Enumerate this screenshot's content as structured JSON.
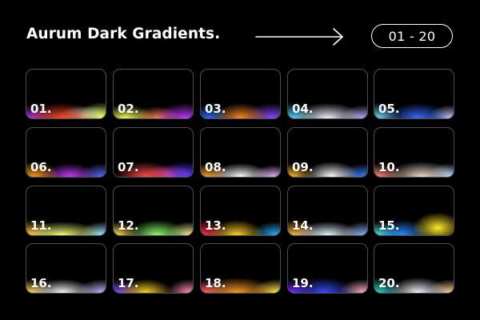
{
  "header": {
    "title": "Aurum Dark Gradients.",
    "range_label": "01 - 20",
    "arrow_icon": "arrow-right-icon"
  },
  "tiles": [
    {
      "label": "01.",
      "gradient": "radial-gradient(ellipse 70% 45% at 45% 100%, #ff4a2a 0%, rgba(255,70,40,0) 70%), radial-gradient(ellipse 45% 40% at 5% 100%, #a02cff 0%, rgba(160,40,255,0) 70%), radial-gradient(ellipse 40% 45% at 95% 100%, #f2ff6a 0%, rgba(240,255,100,0) 75%), radial-gradient(ellipse 50% 30% at 75% 95%, #8ff0d8 0%, rgba(140,240,215,0) 70%), #000"
    },
    {
      "label": "02.",
      "gradient": "radial-gradient(ellipse 55% 45% at 90% 100%, #c038ff 0%, rgba(190,50,255,0) 70%), radial-gradient(ellipse 50% 40% at 15% 100%, #f6ff5a 0%, rgba(240,255,90,0) 70%), radial-gradient(ellipse 45% 35% at 55% 100%, #ff7a5a 0%, rgba(255,120,90,0) 70%), #000"
    },
    {
      "label": "03.",
      "gradient": "radial-gradient(ellipse 50% 45% at 50% 100%, #ff8a2a 0%, rgba(255,130,40,0) 70%), radial-gradient(ellipse 40% 40% at 10% 100%, #2a6bff 0%, rgba(40,100,255,0) 70%), radial-gradient(ellipse 50% 45% at 90% 100%, #8a4bff 0%, rgba(140,70,255,0) 70%), #000"
    },
    {
      "label": "04.",
      "gradient": "radial-gradient(ellipse 65% 45% at 50% 100%, #f0f4ff 0%, rgba(230,240,255,0) 70%), radial-gradient(ellipse 40% 45% at 5% 100%, #4ad6ff 0%, rgba(70,210,255,0) 70%), radial-gradient(ellipse 40% 40% at 95% 100%, #b8a8ff 0%, rgba(180,170,255,0) 70%), #000"
    },
    {
      "label": "05.",
      "gradient": "radial-gradient(ellipse 55% 45% at 55% 100%, #3a6bff 0%, rgba(60,100,255,0) 70%), radial-gradient(ellipse 40% 45% at 5% 100%, #6ad9ff 0%, rgba(100,210,255,0) 70%), radial-gradient(ellipse 40% 40% at 95% 100%, #c4c8ff 0%, rgba(190,200,255,0) 70%), #000"
    },
    {
      "label": "06.",
      "gradient": "radial-gradient(ellipse 45% 45% at 10% 100%, #ff9a1a 0%, rgba(255,150,30,0) 70%), radial-gradient(ellipse 50% 40% at 55% 100%, #c63cff 0%, rgba(190,60,255,0) 70%), radial-gradient(ellipse 40% 40% at 95% 100%, #5a6bff 0%, rgba(90,110,255,0) 70%), #000"
    },
    {
      "label": "07.",
      "gradient": "radial-gradient(ellipse 55% 45% at 40% 100%, #ff4a4a 0%, rgba(255,70,70,0) 70%), radial-gradient(ellipse 50% 45% at 90% 100%, #5a3cff 0%, rgba(90,60,255,0) 70%), radial-gradient(ellipse 50% 35% at 70% 100%, #ff4ab0 0%, rgba(255,70,176,0) 70%), #000"
    },
    {
      "label": "08.",
      "gradient": "radial-gradient(ellipse 55% 40% at 50% 100%, #ffffff 0%, rgba(255,255,255,0) 70%), radial-gradient(ellipse 45% 40% at 8% 100%, #ff9a2a 0%, rgba(255,150,40,0) 70%), radial-gradient(ellipse 40% 35% at 92% 100%, #e8b0ff 0%, rgba(230,176,255,0) 70%), #000"
    },
    {
      "label": "09.",
      "gradient": "radial-gradient(ellipse 40% 40% at 5% 100%, #ffb82a 0%, rgba(255,180,40,0) 70%), radial-gradient(ellipse 50% 45% at 55% 100%, #ffffff 0%, rgba(255,255,255,0) 70%), radial-gradient(ellipse 45% 40% at 95% 100%, #3a7bff 0%, rgba(60,120,255,0) 70%), #000"
    },
    {
      "label": "10.",
      "gradient": "radial-gradient(ellipse 65% 45% at 60% 100%, #f0dccc 0%, rgba(240,220,200,0) 70%), radial-gradient(ellipse 45% 40% at 5% 100%, #ff8a7a 0%, rgba(255,140,120,0) 70%), radial-gradient(ellipse 40% 40% at 95% 100%, #a8d8ff 0%, rgba(170,215,255,0) 70%), #000"
    },
    {
      "label": "11.",
      "gradient": "radial-gradient(ellipse 75% 40% at 45% 100%, #f2ff78 0%, rgba(240,255,120,0) 70%), radial-gradient(ellipse 45% 45% at 5% 100%, #ffb02a 0%, rgba(255,176,40,0) 70%), radial-gradient(ellipse 40% 40% at 95% 100%, #9ae8ff 0%, rgba(150,230,255,0) 70%), #000"
    },
    {
      "label": "12.",
      "gradient": "radial-gradient(ellipse 55% 45% at 55% 100%, #8eff6a 0%, rgba(140,255,100,0) 70%), radial-gradient(ellipse 40% 40% at 5% 100%, #ffd84a 0%, rgba(255,216,74,0) 70%), radial-gradient(ellipse 40% 40% at 95% 100%, #ffe8a0 0%, rgba(255,232,160,0) 70%), #000"
    },
    {
      "label": "13.",
      "gradient": "radial-gradient(ellipse 50% 45% at 45% 100%, #ffd02a 0%, rgba(255,208,40,0) 70%), radial-gradient(ellipse 40% 45% at 5% 100%, #ff2a4a 0%, rgba(255,40,74,0) 70%), radial-gradient(ellipse 45% 40% at 95% 100%, #2ab0ff 0%, rgba(40,176,255,0) 70%), #000"
    },
    {
      "label": "14.",
      "gradient": "radial-gradient(ellipse 60% 40% at 50% 100%, #e8f4ff 0%, rgba(232,244,255,0) 70%), radial-gradient(ellipse 45% 45% at 8% 100%, #ffb03a 0%, rgba(255,176,58,0) 70%), radial-gradient(ellipse 40% 40% at 95% 100%, #8ab0ff 0%, rgba(138,176,255,0) 70%), #000"
    },
    {
      "label": "15.",
      "gradient": "radial-gradient(ellipse 45% 45% at 80% 85%, #ffe82a 0%, rgba(255,232,40,0) 70%), radial-gradient(ellipse 50% 45% at 35% 100%, #2a8bff 0%, rgba(40,139,255,0) 70%), radial-gradient(ellipse 45% 40% at 5% 100%, #4ae8d0 0%, rgba(74,232,208,0) 70%), #000"
    },
    {
      "label": "16.",
      "gradient": "radial-gradient(ellipse 60% 40% at 45% 100%, #f8f8ff 0%, rgba(248,248,255,0) 70%), radial-gradient(ellipse 40% 40% at 5% 100%, #ffd84a 0%, rgba(255,216,74,0) 70%), radial-gradient(ellipse 45% 40% at 95% 100%, #c8b0ff 0%, rgba(200,176,255,0) 70%), #000"
    },
    {
      "label": "17.",
      "gradient": "radial-gradient(ellipse 50% 40% at 40% 100%, #ffd02a 0%, rgba(255,208,40,0) 70%), radial-gradient(ellipse 40% 40% at 5% 100%, #7a4bff 0%, rgba(122,75,255,0) 70%), radial-gradient(ellipse 40% 40% at 95% 100%, #ff8ab0 0%, rgba(255,138,176,0) 70%), #000"
    },
    {
      "label": "18.",
      "gradient": "radial-gradient(ellipse 70% 45% at 45% 100%, #ff9a2a 0%, rgba(255,154,42,0) 70%), radial-gradient(ellipse 45% 40% at 95% 100%, #ffe84a 0%, rgba(255,232,74,0) 70%), radial-gradient(ellipse 40% 40% at 5% 100%, #ff4a6a 0%, rgba(255,74,106,0) 70%), #000"
    },
    {
      "label": "19.",
      "gradient": "radial-gradient(ellipse 55% 45% at 45% 100%, #3a4bff 0%, rgba(58,75,255,0) 70%), radial-gradient(ellipse 45% 40% at 95% 100%, #ffb0c8 0%, rgba(255,176,200,0) 70%), radial-gradient(ellipse 40% 40% at 5% 100%, #7a2aff 0%, rgba(122,42,255,0) 70%), #000"
    },
    {
      "label": "20.",
      "gradient": "radial-gradient(ellipse 55% 45% at 55% 100%, #f4f4ff 0%, rgba(244,244,255,0) 70%), radial-gradient(ellipse 45% 45% at 5% 100%, #2ad0c8 0%, rgba(42,208,200,0) 70%), radial-gradient(ellipse 40% 40% at 95% 100%, #ffd0a0 0%, rgba(255,208,160,0) 70%), #000"
    }
  ]
}
